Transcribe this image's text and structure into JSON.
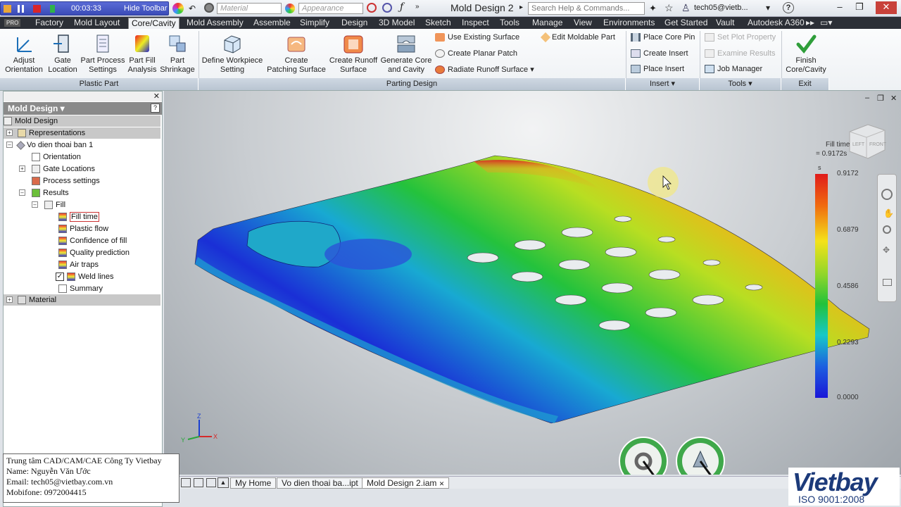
{
  "recorder": {
    "time": "00:03:33",
    "hide_label": "Hide Toolbar"
  },
  "quick_access": {
    "material": "Material",
    "appearance": "Appearance"
  },
  "window": {
    "title": "Mold Design 2",
    "search_placeholder": "Search Help & Commands...",
    "user": "tech05@vietb..."
  },
  "menu": {
    "pro": "PRO",
    "tabs": [
      "Factory",
      "Mold Layout",
      "Core/Cavity",
      "Mold Assembly",
      "Assemble",
      "Simplify",
      "Design",
      "3D Model",
      "Sketch",
      "Inspect",
      "Tools",
      "Manage",
      "View",
      "Environments",
      "Get Started",
      "Vault",
      "Autodesk A360"
    ],
    "active": "Core/Cavity"
  },
  "ribbon": {
    "plastic_part": {
      "label": "Plastic Part",
      "buttons": [
        {
          "l1": "Adjust",
          "l2": "Orientation"
        },
        {
          "l1": "Gate",
          "l2": "Location"
        },
        {
          "l1": "Part Process",
          "l2": "Settings"
        },
        {
          "l1": "Part Fill",
          "l2": "Analysis"
        },
        {
          "l1": "Part",
          "l2": "Shrinkage"
        }
      ]
    },
    "parting_design": {
      "label": "Parting Design",
      "buttons": [
        {
          "l1": "Define Workpiece",
          "l2": "Setting"
        },
        {
          "l1": "Create",
          "l2": "Patching Surface"
        },
        {
          "l1": "Create Runoff",
          "l2": "Surface"
        },
        {
          "l1": "Generate Core",
          "l2": "and Cavity"
        }
      ],
      "small": [
        "Use Existing Surface",
        "Create Planar Patch",
        "Radiate Runoff Surface",
        "Edit Moldable Part"
      ]
    },
    "insert": {
      "label": "Insert",
      "small": [
        "Place Core Pin",
        "Create Insert",
        "Place Insert"
      ]
    },
    "tools": {
      "label": "Tools",
      "small": [
        "Set Plot Property",
        "Examine Results",
        "Job Manager"
      ]
    },
    "exit": {
      "label": "Exit",
      "l1": "Finish",
      "l2": "Core/Cavity"
    }
  },
  "browser": {
    "title": "Mold Design",
    "rows": [
      "Mold Design",
      "Representations",
      "Vo dien thoai ban 1",
      "Orientation",
      "Gate Locations",
      "Process settings",
      "Results",
      "Fill",
      "Fill time",
      "Plastic flow",
      "Confidence of fill",
      "Quality prediction",
      "Air traps",
      "Weld lines",
      "Summary",
      "Material"
    ],
    "weld_lines_checked": true
  },
  "info": {
    "line1": "Trung tâm CAD/CAM/CAE Công Ty Vietbay",
    "line2": "Name: Nguyễn Văn Ước",
    "line3": "Email: tech05@vietbay.com.vn",
    "line4": "Mobifone: 0972004415"
  },
  "legend": {
    "title1": "Fill time",
    "title2": "= 0.9172s",
    "unit": "s",
    "values": [
      "0.9172",
      "0.6879",
      "0.4586",
      "0.2293",
      "0.0000"
    ]
  },
  "axes": {
    "z": "Z",
    "y": "Y",
    "x": "X"
  },
  "viewcube": {
    "left": "LEFT",
    "front": "FRONT"
  },
  "doc_tabs": [
    "My Home",
    "Vo dien thoai ba...ipt",
    "Mold Design 2.iam"
  ],
  "brand": {
    "name": "Vietbay",
    "iso": "ISO 9001:2008"
  },
  "colors": {
    "accent": "#3b4cb8",
    "menu_bg": "#2c2f36",
    "legend_top": "#e01b1b",
    "legend_bottom": "#1a16d8"
  }
}
